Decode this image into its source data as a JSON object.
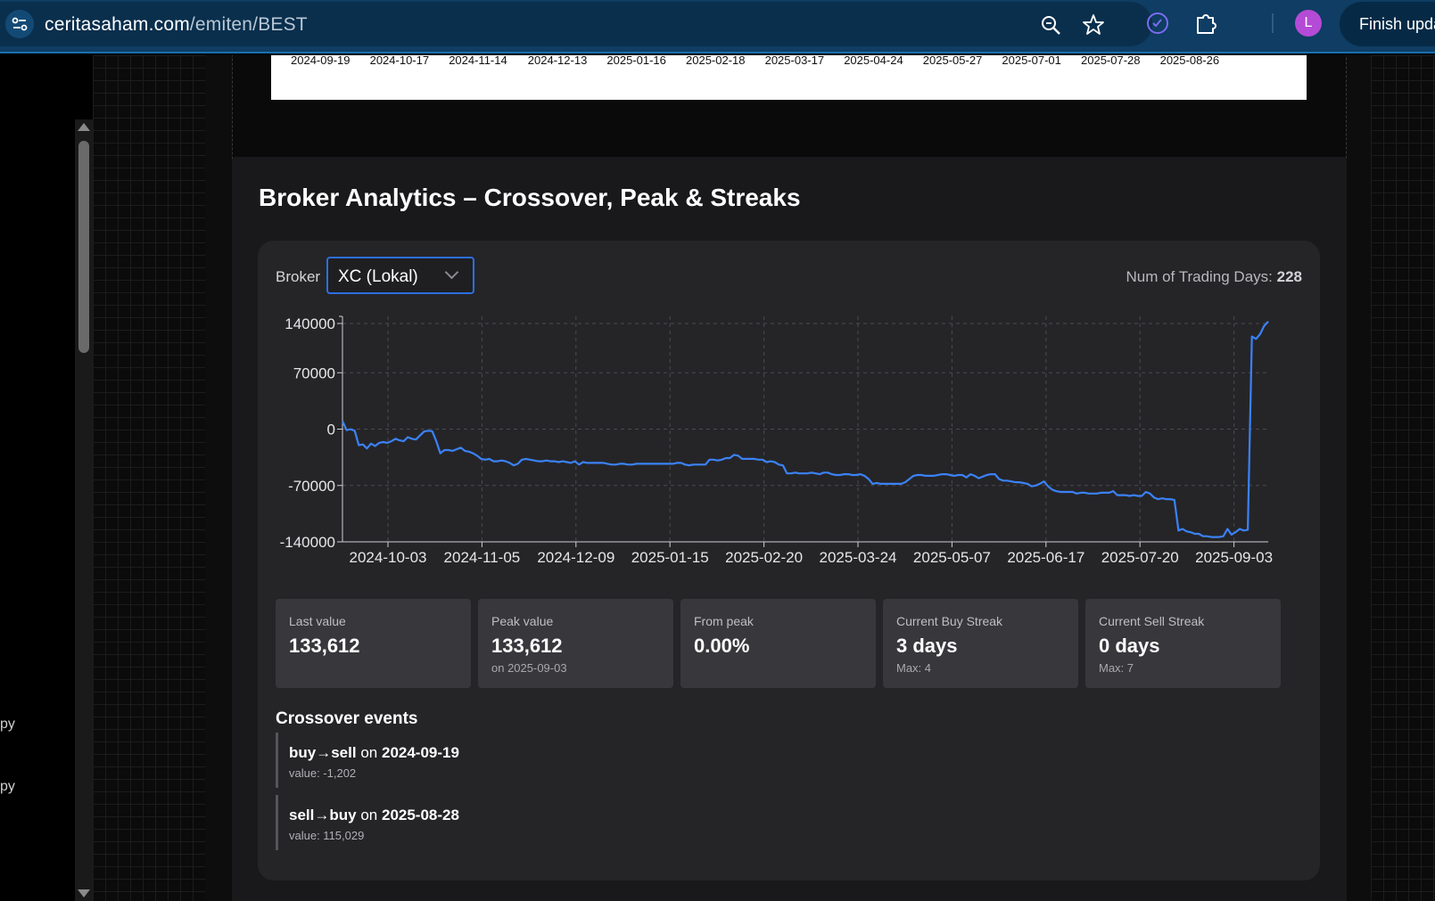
{
  "browser": {
    "url_host": "ceritasaham.com",
    "url_path": "/emiten/BEST",
    "profile_initial": "L",
    "finish_update_label": "Finish upda"
  },
  "sidebar": {
    "fragment_1": "py",
    "fragment_2": "py"
  },
  "previous_chart": {
    "date_ticks": [
      "2024-09-19",
      "2024-10-17",
      "2024-11-14",
      "2024-12-13",
      "2025-01-16",
      "2025-02-18",
      "2025-03-17",
      "2025-04-24",
      "2025-05-27",
      "2025-07-01",
      "2025-07-28",
      "2025-08-26"
    ]
  },
  "section": {
    "title": "Broker Analytics – Crossover, Peak & Streaks"
  },
  "controls": {
    "broker_label": "Broker",
    "broker_selected": "XC (Lokal)",
    "num_days_label": "Num of Trading Days:",
    "num_days_value": "228"
  },
  "chart_data": {
    "type": "line",
    "line_color": "#3b82f6",
    "grid": true,
    "ylim": [
      -140000,
      140000
    ],
    "y_ticks": [
      "140000",
      "70000",
      "0",
      "-70000",
      "-140000"
    ],
    "x_ticks": [
      "2024-10-03",
      "2024-11-05",
      "2024-12-09",
      "2025-01-15",
      "2025-02-20",
      "2025-03-24",
      "2025-05-07",
      "2025-06-17",
      "2025-07-20",
      "2025-09-03"
    ],
    "series": [
      {
        "values": [
          10000,
          -1202,
          -200,
          -2000,
          -20000,
          -19000,
          -24000,
          -18000,
          -21000,
          -17000,
          -16000,
          -17000,
          -15000,
          -12000,
          -14000,
          -15000,
          -10000,
          -12000,
          -13000,
          -8000,
          -3000,
          -2000,
          -2500,
          -15000,
          -30000,
          -26000,
          -26000,
          -27000,
          -25000,
          -23000,
          -27000,
          -28000,
          -30000,
          -33000,
          -37000,
          -38000,
          -37000,
          -40000,
          -40000,
          -39000,
          -40000,
          -42000,
          -45000,
          -43000,
          -38000,
          -37000,
          -38000,
          -39000,
          -40000,
          -40000,
          -39000,
          -40000,
          -40000,
          -41000,
          -40000,
          -41000,
          -42000,
          -40000,
          -44000,
          -41000,
          -42000,
          -42000,
          -42000,
          -42000,
          -42000,
          -43000,
          -44000,
          -44000,
          -43000,
          -43000,
          -44000,
          -44000,
          -43000,
          -43000,
          -43000,
          -43000,
          -43000,
          -43000,
          -43000,
          -43000,
          -43000,
          -43000,
          -42000,
          -42000,
          -44000,
          -45000,
          -44000,
          -44000,
          -44000,
          -44000,
          -38000,
          -38000,
          -39000,
          -38000,
          -36000,
          -36000,
          -32000,
          -33000,
          -37000,
          -37000,
          -37000,
          -37000,
          -38000,
          -38000,
          -41000,
          -40000,
          -41000,
          -44000,
          -45000,
          -55000,
          -55000,
          -54000,
          -55000,
          -55000,
          -55000,
          -54000,
          -55000,
          -56000,
          -54000,
          -54000,
          -56000,
          -57000,
          -57000,
          -56000,
          -56000,
          -57000,
          -57000,
          -56000,
          -58000,
          -62000,
          -68000,
          -67000,
          -68000,
          -68000,
          -68000,
          -68000,
          -68000,
          -68000,
          -66000,
          -62000,
          -58000,
          -57000,
          -57000,
          -58000,
          -58000,
          -58000,
          -57000,
          -56000,
          -56000,
          -57000,
          -58000,
          -57000,
          -57000,
          -60000,
          -56000,
          -58000,
          -61000,
          -59000,
          -57000,
          -56000,
          -56000,
          -62000,
          -64000,
          -64000,
          -65000,
          -66000,
          -66000,
          -67000,
          -68000,
          -71000,
          -70000,
          -68000,
          -65000,
          -71000,
          -75000,
          -77000,
          -78000,
          -78000,
          -78000,
          -78000,
          -80000,
          -79000,
          -79000,
          -80000,
          -80000,
          -80000,
          -79000,
          -79000,
          -79000,
          -77000,
          -82000,
          -82000,
          -82000,
          -83000,
          -82000,
          -83000,
          -83000,
          -78000,
          -80000,
          -85000,
          -87000,
          -86000,
          -87000,
          -87000,
          -88000,
          -126000,
          -124000,
          -127000,
          -128000,
          -130000,
          -130000,
          -133000,
          -133000,
          -134000,
          -134000,
          -134000,
          -133000,
          -124000,
          -131000,
          -128000,
          -124000,
          -126000,
          -125000,
          115029,
          112000,
          118000,
          128000,
          133612
        ]
      }
    ]
  },
  "stats": [
    {
      "label": "Last value",
      "value": "133,612",
      "sub": ""
    },
    {
      "label": "Peak value",
      "value": "133,612",
      "sub": "on 2025-09-03"
    },
    {
      "label": "From peak",
      "value": "0.00%",
      "sub": ""
    },
    {
      "label": "Current Buy Streak",
      "value": "3 days",
      "sub": "Max: 4"
    },
    {
      "label": "Current Sell Streak",
      "value": "0 days",
      "sub": "Max: 7"
    }
  ],
  "crossover": {
    "title": "Crossover events",
    "on_word": "on",
    "events": [
      {
        "type": "buy→sell",
        "date": "2024-09-19",
        "value": "value: -1,202"
      },
      {
        "type": "sell→buy",
        "date": "2025-08-28",
        "value": "value: 115,029"
      }
    ]
  }
}
